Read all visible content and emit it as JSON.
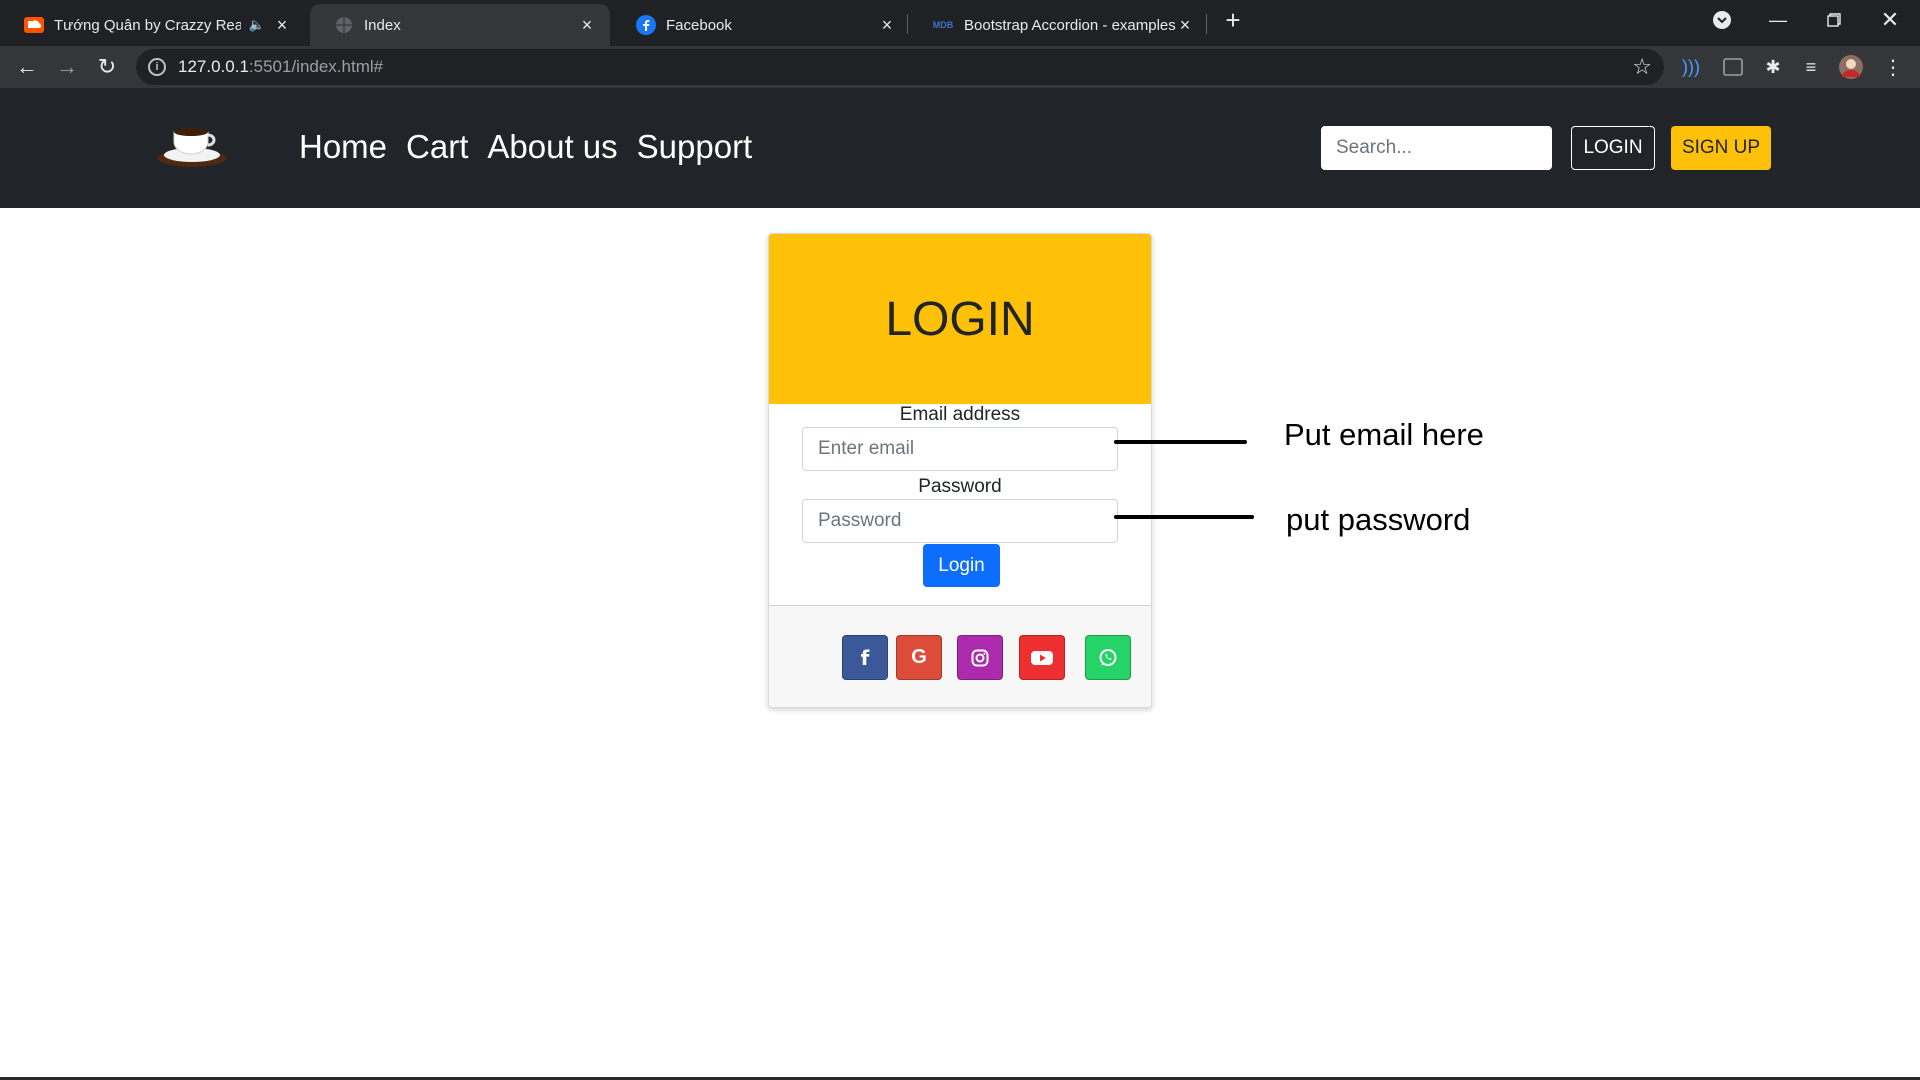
{
  "browser": {
    "tabs": [
      {
        "title": "Tướng Quân by Crazzy Reade",
        "favicon": "soundcloud-icon",
        "audio": true,
        "active": false
      },
      {
        "title": "Index",
        "favicon": "globe-icon",
        "active": true
      },
      {
        "title": "Facebook",
        "favicon": "facebook-icon",
        "active": false
      },
      {
        "title": "Bootstrap Accordion - examples &",
        "favicon": "mdb-icon",
        "favicon_text": "MDB",
        "active": false
      }
    ],
    "new_tab": "+",
    "url_host": "127.0.0.1",
    "url_rest": ":5501/index.html#"
  },
  "navbar": {
    "links": [
      "Home",
      "Cart",
      "About us",
      "Support"
    ],
    "search_placeholder": "Search...",
    "login_label": "LOGIN",
    "signup_label": "SIGN UP"
  },
  "card": {
    "header": "LOGIN",
    "email_label": "Email address",
    "email_placeholder": "Enter email",
    "password_label": "Password",
    "password_placeholder": "Password",
    "submit_label": "Login",
    "social": [
      {
        "name": "facebook",
        "glyph": "f",
        "color": "#3b5998"
      },
      {
        "name": "google",
        "glyph": "G",
        "color": "#dd4b39"
      },
      {
        "name": "instagram",
        "glyph": "",
        "color": "#ac2bac"
      },
      {
        "name": "youtube",
        "glyph": "",
        "color": "#ed302f"
      },
      {
        "name": "whatsapp",
        "glyph": "",
        "color": "#25d366"
      }
    ]
  },
  "annotations": {
    "email_note": "Put email here",
    "password_note": "put password"
  },
  "colors": {
    "accent_yellow": "#ffc107",
    "primary_blue": "#0d6efd",
    "navbar_bg": "#212529"
  }
}
